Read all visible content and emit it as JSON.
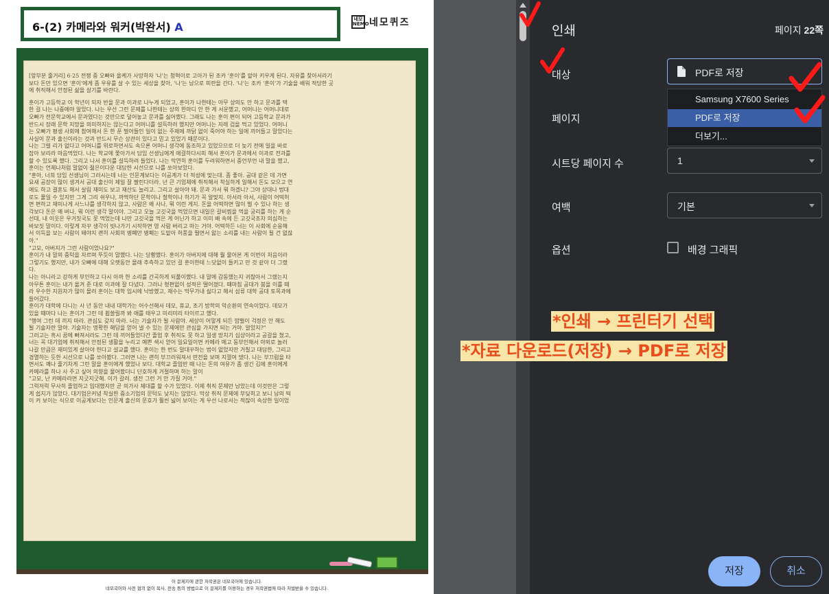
{
  "document": {
    "title_prefix": "6-(2) 카메라와 워커(박완서)",
    "title_version": "A",
    "brand_logo": "네모 NEMO",
    "brand_name": "네모퀴즈",
    "lines": [
      "[앞부분 줄거리] 6·25 전쟁 중 오빠와 올케가 사망하자 '나'는 청혁이로 고아가 된 조카 '훈이'를 맡아 키우게 된다. 자유를 찾아서라기",
      "보다 돈만 있으면 '훈이'에게 좀 우유를 살 수 있는 세상을 찾아, '나'는 남으로 피란을 간다. '나'는 조카 '훈이'가 기술을 배워 적당한 곳",
      "에 취직해서 안정된 삶을 살기를 바란다.",
      "",
      "훈이가 고등학교 이 학년이 되자 반을 문과 이과로 나누게 되었고, 훈이가 나한테는 아무 상의도 안 하고 문과를 택",
      "한 걸 나는 나중에야 알았다. 나는 우선 그런 문제를 나한테는 상의 한마디 안 한 게 서운했고, 어머니는 어머니대로",
      "오빠가 전문학교에서 문과였다는 것만으로 덮어놓고 문과를 싫어했다. 그래도 나는 훈이 편이 되어 고등학교 문과가",
      "반드시 장래 문학 지망을 의미하지는 않는다고 어머니를 설득하려 했지만 어머니는 지레 겁을 먹고 있었다. 어머니",
      "는 오빠가 평생 사회에 참여해서 돈 한 푼 벌어들인 일이 없는 주제에 까닭 없이 죽어야 하는 일에 끼어들고 말았다는",
      "사실이 문과 출신이라는 것과 반드시 무슨 상관이 있다고 믿고 있었기 때문이다.",
      "나는 그럴 리가 없다고 어머니를 위로하면서도 속으론 어머니 생각에 동조하고 있었으므로 더 늦기 전에 일을 바로",
      "잡아 보리라 마음먹었다. 나는 학교에 쫓아가서 담임 선생님에게 애걸하다시피 해서 훈이가 문과에서 이과로 전과를",
      "할 수 있도록 했다. 그리고 나서 훈이를 설득하려 들었다. 나는 막연히 훈이를 두려워하면서 중언부언 내 말을 했고,",
      "훈이는 언제나처럼 말없이 젊은이다운 대담한 시선으로 나를 쏘아보았다.",
      "\"훈아, 너희 담임 선생님이 그러시는데 너는 인문계보다는 이공계가 더 적성에 맞는대. 좀 좋아. 공대 같은 데 가면",
      "요새 공장이 많이 생겨서 공대 출신이 제일 잘 팔린다더라. 넌 큰 기업체에 취직해서 착실하게 일해서 돈도 모으고 연",
      "애도 하고 결혼도 해서 살림 재미도 보고 재산도 늘리고. 그리고 살아야 돼. 문과 가서 뭐 하겠니? 그야 상대나 법대",
      "로도 풀일 수 있지만 그게 그리 쉬우냐, 까딱하단 문학이나 철학이나 하기가 꼭 알맞지. 아서라 아서, 사람이 어떡허",
      "면 편하고 재미나게 사느냐를 생각하지 않고, 사람은 왜 사나, 뭐 이런 게지. 돈을 어떡하면 많이 벌 수 있나 하는 생",
      "각보다 돈은 왜 버나, 뭐 이런 생각 말이야. 그리고 오늘 고깃국을 먹었으면 내일은 갈비찜을 먹을 궁리를 하는 게 순",
      "선대, 내 이웃은 우거짓국도 못 먹었는데 나만 고깃국을 먹은 게 어닌가 하고 이미 배 속에 든 고깃국조차 의심하는",
      "바보짓 말이다. 이렇게 자꾸 생각이 빗나가기 시작하면 영 사람 버리고 마는 거야. 어떡하든 너는 이 사회에 순응해",
      "서 이득을 보는 사람이 돼야지 괜히 사회의 병폐만 병폐는 도맡아 허풍을 떨면서 앓는 소리를 내는 사람이 될 건 없잖",
      "아.\"",
      "\"고모, 아버지가 그런 사람이었나요?\"",
      "훈이가 내 말의 중턱을 자르며 뚜듯이 말했다. 나는 당황했다. 훈이가 아버지에 대해 뭘 물어본 게 이번이 처음이라",
      "그렇기도 했지만, 내가 오빠에 대해 오랫동안 몰래 추측하고 있던 걸 훈이한테 느닷없이 들키고 만 것 같아 더 그랬",
      "다.",
      "나는 아니라고 강하게 부인하고 다시 아까 한 소리를 간곡하게 되풀이했다. 내 말에 감동했는지 귀찮아서 그랬는지",
      "아무튼 훈이는 내가 옮겨 준 대로 이과에 잘 다녔다. 그러나 형편없이 성적은 떨어졌다. 때마침 공대가 붐을 이룰 때",
      "라 우수한 지원자가 많이 몰려 훈이는 대학 입시에 낙방했고, 재수는 막무가내 싫다고 해서 삼류 대학 공대 토목과에",
      "들어갔다.",
      "훈이가 대학에 다니는 사 년 동안 내내 대학가는 어수선해서 데모, 휴교, 조기 방학의 악순환의 연속이었다. 데모가",
      "있을 때마다 나는 훈이가 그런 데 휩쓸릴까 봐 애를 태우고 미리미리 타이르고 했다.",
      "\"행여 그런 데 끼지 마라. 관심도 갖지 마라. 너는 기술자가 될 사람야. 세상이 어떻게 되든 밥벌이 걱정은 안 해도",
      "될 기술자란 말야. 기술자는 명확한 해답을 얻어 낼 수 있는 문제에만 관심을 가지면 되는 거야. 알았지?\"",
      "그러고는 흑시 꿈에 빠져서라도 그런 데 끼어들었다간 졸업 후 취직도 못 하고 일생 망치기 십상이라고 공갈을 쳤고,",
      "너는 꼭 대기업에 취직해서 안정된 생활을 누리고 예쁜 색시 얻어 일요일이면 카메라 메고 동부인해서 야외로 놀러",
      "나갈 만큼은 재미있게 살아야 한다고 설교를 했다. 훈이는 한 번도 말대꾸하는 법이 없었지만 거칠고 대담한, 그리고",
      "경멸하는 듯한 시선으로 나를 쏘아봤다. 그러면 나는 괜히 부끄러워져서 딴전을 보며 지껄여 댔다. 나는 부끄럼을 타",
      "면서도 꽤나 줄기차게 그런 말을 훈이에게 했었나 보다. 대학교 졸업반 때 나는 돈의 여유가 좀 생긴 김에 훈이에게",
      "카메라를 하나 사 주고 싶어 의향을 물어봤더니 단호하게 거절하며 하는 말이",
      "\"고모, 난 카메라라면 지긋지긋해. 이가 갈려. 생전 그런 거 안 가질 거야.\"",
      "그럭저럭 무사히 졸업하고 입대했지만 곧 의가사 제대를 할 수가 있었다. 이제 취직 문제만 남았는데 이것만은 그렇",
      "게 쉽지가 않았다. 대기업은커녕 착실한 중소기업의 문턱도 낮지는 않았다. 막상 취직 문제에 부딪히고 보니 남의 떡",
      "이 커 보이는 식으로 이공계보다는 인문계 출신의 문호가 훨씬 넓어 보이는 게 우선 나로서는 적잖이 속상한 일이었"
    ],
    "footer_line1": "이 문제지에 관한 저작권은 네모국어에 있습니다.",
    "footer_line2": "네모국어와 사전 협의 없이 복사, 전송 등의 방법으로 이 문제지를 이용하는 경우 저작권법에 따라 처벌받을 수 있습니다."
  },
  "print_panel": {
    "title": "인쇄",
    "pages_prefix": "페이지 ",
    "pages_count": "22쪽",
    "destination_label": "대상",
    "destination_value": "PDF로 저장",
    "dropdown_options": [
      "Samsung X7600 Series",
      "PDF로 저장",
      "더보기..."
    ],
    "pages_label": "페이지",
    "pages_per_sheet_label": "시트당 페이지 수",
    "pages_per_sheet_value": "1",
    "margins_label": "여백",
    "margins_value": "기본",
    "options_label": "옵션",
    "background_graphics_label": "배경 그래픽",
    "background_graphics_checked": false,
    "save_button": "저장",
    "cancel_button": "취소",
    "accent_color": "#8ab4f8"
  },
  "annotations": {
    "note1": "*인쇄 → 프린터기 선택",
    "note2": "*자료 다운로드(저장) → PDF로 저장",
    "note_color": "#e84d1c",
    "check_color": "#ff1a1a"
  }
}
